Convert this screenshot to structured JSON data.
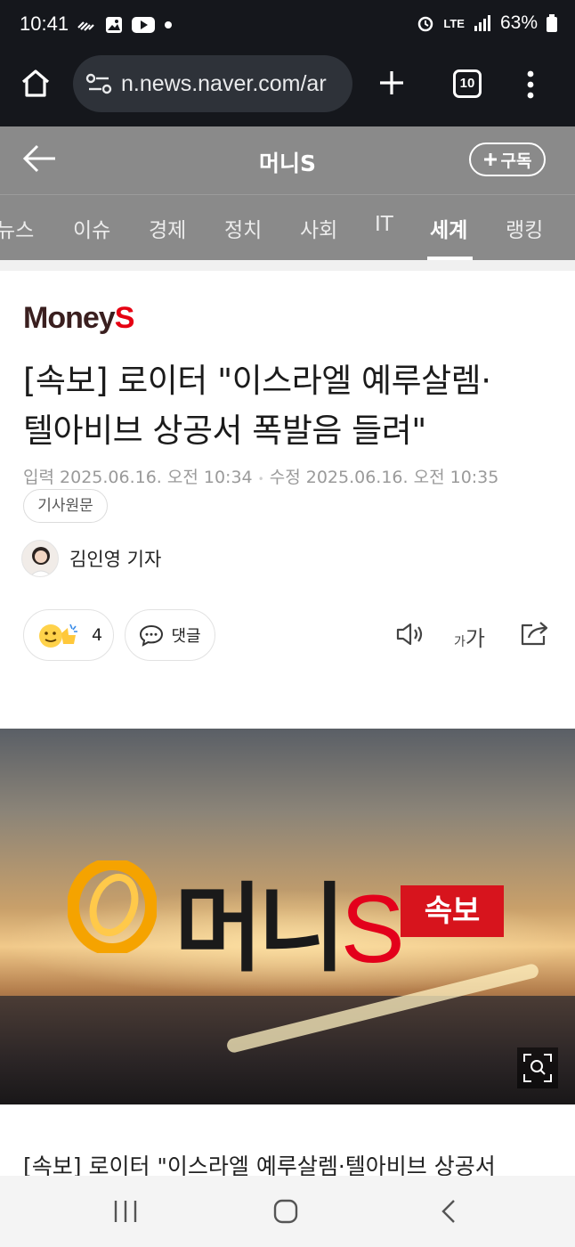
{
  "status_bar": {
    "time": "10:41",
    "network": "LTE",
    "battery": "63%"
  },
  "browser": {
    "url": "n.news.naver.com/ar",
    "tab_count": "10"
  },
  "header": {
    "press_name": "머니S",
    "subscribe_label": "구독"
  },
  "categories": [
    {
      "label": "뉴스",
      "active": false
    },
    {
      "label": "이슈",
      "active": false
    },
    {
      "label": "경제",
      "active": false
    },
    {
      "label": "정치",
      "active": false
    },
    {
      "label": "사회",
      "active": false
    },
    {
      "label": "IT",
      "active": false
    },
    {
      "label": "세계",
      "active": true
    },
    {
      "label": "랭킹",
      "active": false
    }
  ],
  "article": {
    "logo_main": "Money",
    "logo_accent": "S",
    "headline_line1": "[속보] 로이터 \"이스라엘 예루살렘·",
    "headline_line2": "텔아비브 상공서 폭발음 들려\"",
    "input_label": "입력",
    "input_date": "2025.06.16. 오전 10:34",
    "edit_label": "수정",
    "edit_date": "2025.06.16. 오전 10:35",
    "original_label": "기사원문",
    "reporter": "김인영 기자",
    "reaction_count": "4",
    "comment_label": "댓글",
    "font_small": "가",
    "font_large": "가",
    "body_start": "[속보] 로이터 \"이스라엘 예루살렘·텔아비브 상공서"
  },
  "hero_image": {
    "brand_text": "머니",
    "brand_accent": "S",
    "badge": "속보"
  },
  "colors": {
    "header_bg": "#8a8a8a",
    "browser_bg": "#15171c",
    "brand_red": "#e3001b"
  }
}
